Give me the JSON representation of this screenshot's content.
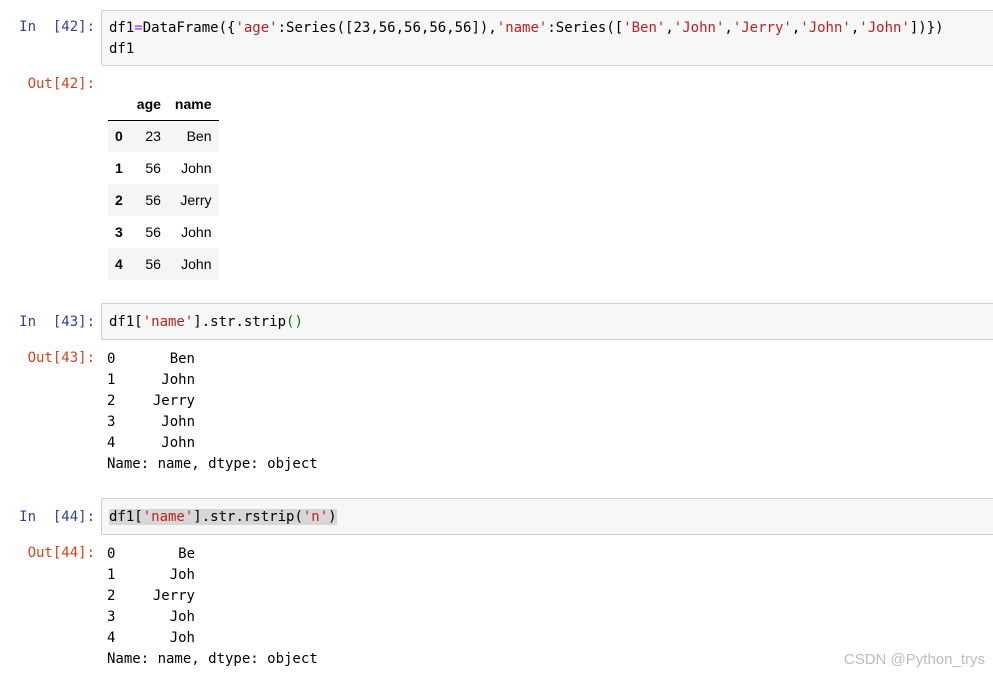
{
  "cells": [
    {
      "in_prompt": "In  [42]:",
      "code": {
        "line1": {
          "a": "df1",
          "eq": "=",
          "b": "DataFrame({",
          "s1": "'age'",
          "c": ":Series([23,56,56,56,56]),",
          "s2": "'name'",
          "d": ":Series([",
          "s3": "'Ben'",
          "e": ",",
          "s4": "'John'",
          "f": ",",
          "s5": "'Jerry'",
          "g": ",",
          "s6": "'John'",
          "h": ",",
          "s7": "'John'",
          "i": "])})"
        },
        "line2": "df1"
      },
      "out_prompt": "Out[42]:",
      "table": {
        "columns": [
          "age",
          "name"
        ],
        "rows": [
          {
            "index": "0",
            "age": "23",
            "name": "Ben"
          },
          {
            "index": "1",
            "age": "56",
            "name": "John"
          },
          {
            "index": "2",
            "age": "56",
            "name": "Jerry"
          },
          {
            "index": "3",
            "age": "56",
            "name": "John"
          },
          {
            "index": "4",
            "age": "56",
            "name": "John"
          }
        ]
      }
    },
    {
      "in_prompt": "In  [43]:",
      "code": {
        "a": "df1[",
        "s1": "'name'",
        "b": "].str.strip",
        "p": "()"
      },
      "out_prompt": "Out[43]:",
      "series": {
        "rows": [
          {
            "index": "0",
            "value": "Ben"
          },
          {
            "index": "1",
            "value": "John"
          },
          {
            "index": "2",
            "value": "Jerry"
          },
          {
            "index": "3",
            "value": "John"
          },
          {
            "index": "4",
            "value": "John"
          }
        ],
        "footer": "Name: name, dtype: object"
      }
    },
    {
      "in_prompt": "In  [44]:",
      "code": {
        "a": "df1[",
        "s1": "'name'",
        "b": "].str.rstrip(",
        "s2": "'n'",
        "c": ")"
      },
      "out_prompt": "Out[44]:",
      "series": {
        "rows": [
          {
            "index": "0",
            "value": "Be"
          },
          {
            "index": "1",
            "value": "Joh"
          },
          {
            "index": "2",
            "value": "Jerry"
          },
          {
            "index": "3",
            "value": "Joh"
          },
          {
            "index": "4",
            "value": "Joh"
          }
        ],
        "footer": "Name: name, dtype: object"
      }
    }
  ],
  "watermark": "CSDN @Python_trys",
  "colors": {
    "in_prompt": "#303f9f",
    "out_prompt": "#d84315",
    "string": "#ba2121",
    "operator": "#aa22ff",
    "paren": "#008000"
  }
}
